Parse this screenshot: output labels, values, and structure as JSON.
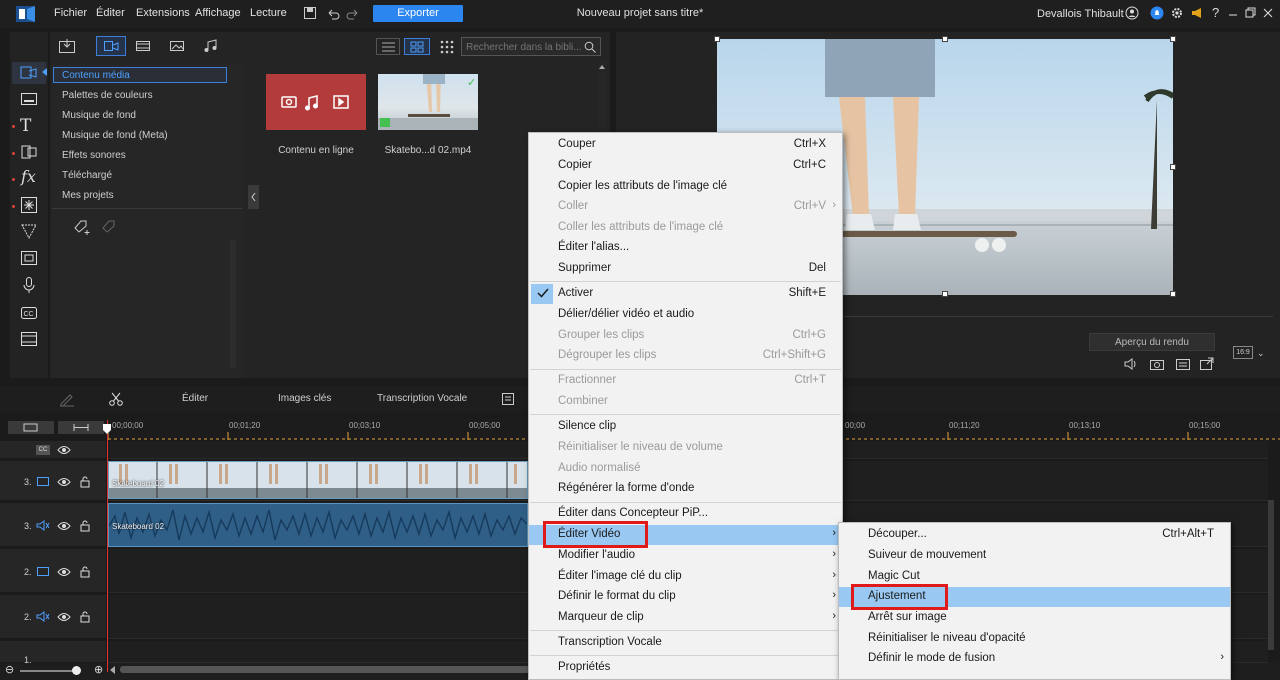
{
  "menu": [
    "Fichier",
    "Éditer",
    "Extensions",
    "Affichage",
    "Lecture"
  ],
  "export_label": "Exporter",
  "document_title": "Nouveau projet sans titre*",
  "user_name": "Devallois Thibault",
  "library": {
    "search_placeholder": "Rechercher dans la bibli...",
    "categories": [
      "Contenu média",
      "Palettes de couleurs",
      "Musique de fond",
      "Musique de fond (Meta)",
      "Effets sonores",
      "Téléchargé",
      "Mes projets"
    ],
    "thumbs": [
      "Contenu en ligne",
      "Skatebo...d 02.mp4"
    ]
  },
  "preview": {
    "render_label": "Aperçu du rendu",
    "aspect_label": "16:9"
  },
  "timeline": {
    "tools": [
      "Éditer",
      "Images clés",
      "Transcription Vocale"
    ],
    "ruler": [
      "00;00;00",
      "00;01;20",
      "00;03;10",
      "00;05;00",
      "00;00",
      "00;11;20",
      "00;13;10",
      "00;15;00"
    ],
    "tracks": [
      "3.",
      "3.",
      "2.",
      "2.",
      "1."
    ],
    "video_clip_name": "Skateboard 02",
    "audio_clip_name": "Skateboard 02",
    "cc_label": "CC"
  },
  "context_menu": [
    {
      "label": "Couper",
      "shortcut": "Ctrl+X"
    },
    {
      "label": "Copier",
      "shortcut": "Ctrl+C"
    },
    {
      "label": "Copier les attributs de l'image clé",
      "shortcut": ""
    },
    {
      "label": "Coller",
      "shortcut": "Ctrl+V"
    },
    {
      "label": "Coller les attributs de l'image clé",
      "shortcut": ""
    },
    {
      "label": "Éditer l'alias...",
      "shortcut": ""
    },
    {
      "label": "Supprimer",
      "shortcut": "Del"
    },
    {
      "label": "Activer",
      "shortcut": "Shift+E"
    },
    {
      "label": "Délier/délier vidéo et audio",
      "shortcut": ""
    },
    {
      "label": "Grouper les clips",
      "shortcut": "Ctrl+G"
    },
    {
      "label": "Dégrouper les clips",
      "shortcut": "Ctrl+Shift+G"
    },
    {
      "label": "Fractionner",
      "shortcut": "Ctrl+T"
    },
    {
      "label": "Combiner",
      "shortcut": ""
    },
    {
      "label": "Silence clip",
      "shortcut": ""
    },
    {
      "label": "Réinitialiser le niveau de volume",
      "shortcut": ""
    },
    {
      "label": "Audio normalisé",
      "shortcut": ""
    },
    {
      "label": "Régénérer la forme d'onde",
      "shortcut": ""
    },
    {
      "label": "Éditer dans Concepteur PiP...",
      "shortcut": ""
    },
    {
      "label": "Éditer Vidéo",
      "shortcut": ""
    },
    {
      "label": "Modifier l'audio",
      "shortcut": ""
    },
    {
      "label": "Éditer l'image clé du clip",
      "shortcut": ""
    },
    {
      "label": "Définir le format du clip",
      "shortcut": ""
    },
    {
      "label": "Marqueur de clip",
      "shortcut": ""
    },
    {
      "label": "Transcription Vocale",
      "shortcut": ""
    },
    {
      "label": "Propriétés",
      "shortcut": ""
    }
  ],
  "submenu": [
    {
      "label": "Découper...",
      "shortcut": "Ctrl+Alt+T"
    },
    {
      "label": "Suiveur de mouvement",
      "shortcut": ""
    },
    {
      "label": "Magic Cut",
      "shortcut": ""
    },
    {
      "label": "Ajustement",
      "shortcut": ""
    },
    {
      "label": "Arrêt sur image",
      "shortcut": ""
    },
    {
      "label": "Réinitialiser le niveau d'opacité",
      "shortcut": ""
    },
    {
      "label": "Définir le mode de fusion",
      "shortcut": ""
    }
  ],
  "colors": {
    "accent": "#2b86f0",
    "highlight": "#99c9f2",
    "callout": "#e01919",
    "playhead": "#e03131"
  }
}
